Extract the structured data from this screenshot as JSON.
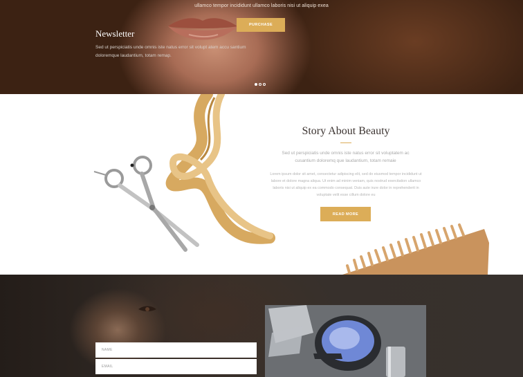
{
  "hero": {
    "text": "ullamco tempor incididunt ullamco laboris nisi ut aliquip exea",
    "purchase_label": "PURCHASE",
    "slides": 3,
    "active_slide": 1
  },
  "story": {
    "title": "Story About Beauty",
    "lead": "Sed ut perspiciatis unde omnis iste natus error sit voluptatem ac cusantium doloremq que laudantium, totam remaie",
    "body": "Lorem ipsum dolor sit amet, consectetur adipiscing elit, sed do eiusmod tempor incididunt ut labore et dolore magna aliqua. Ut enim ad minim veniam, quis nostrud exercitation ullamco laboris nisi ut aliquip ex ea commodo consequat. Duis aute irure dolor in reprehenderit in voluptate velit esse cillum dolore eu",
    "read_more_label": "READ MORE"
  },
  "newsletter": {
    "title": "Newsletter",
    "description": "Sed ut perspiciatis unde omnis iste natus error sit volupt atem accu santium doloremque laudantium, totam remap.",
    "name_placeholder": "NAME",
    "email_placeholder": "EMAIL"
  },
  "colors": {
    "accent": "#dcad58",
    "dark_bg": "#37312d",
    "title_text": "#3b3330"
  }
}
